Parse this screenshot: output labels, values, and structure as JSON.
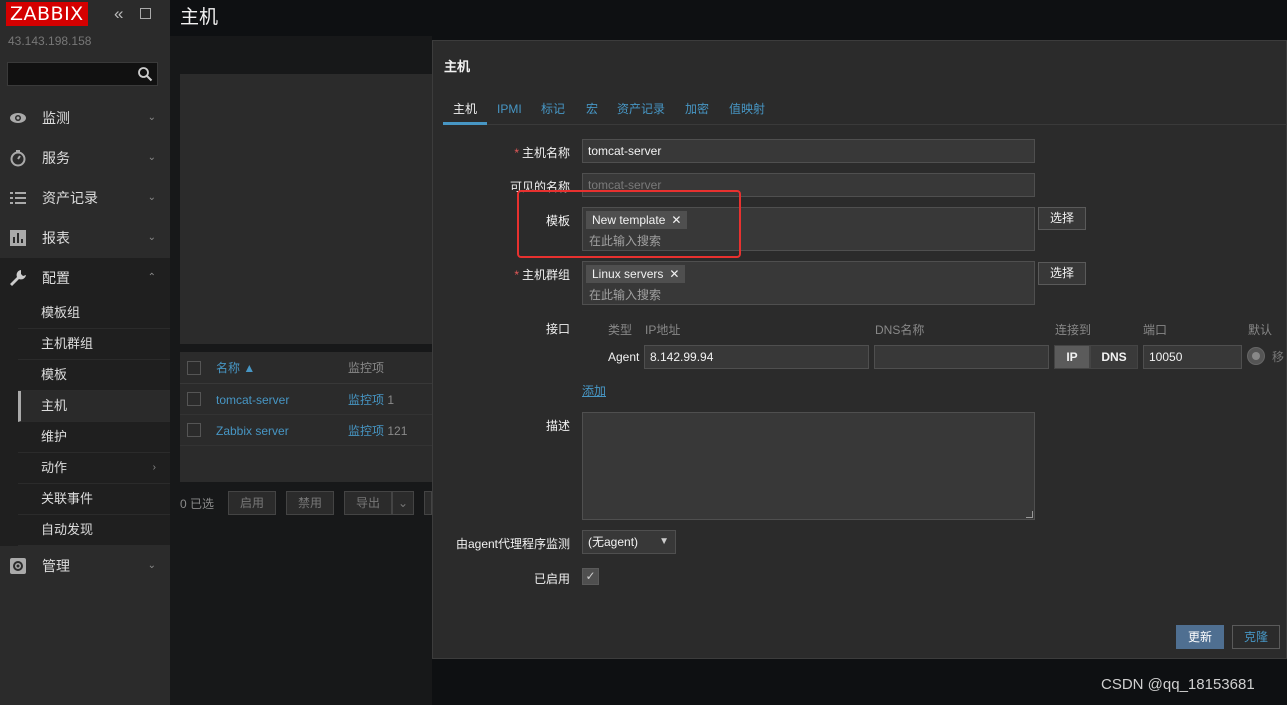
{
  "sidebar": {
    "logo": "ZABBIX",
    "server_ip": "43.143.198.158",
    "menu": [
      {
        "label": "监测",
        "icon": "eye-icon"
      },
      {
        "label": "服务",
        "icon": "stopwatch-icon"
      },
      {
        "label": "资产记录",
        "icon": "list-icon"
      },
      {
        "label": "报表",
        "icon": "bar-chart-icon"
      },
      {
        "label": "配置",
        "icon": "wrench-icon"
      },
      {
        "label": "管理",
        "icon": "gear-icon"
      }
    ],
    "submenu": [
      {
        "label": "模板组"
      },
      {
        "label": "主机群组"
      },
      {
        "label": "模板"
      },
      {
        "label": "主机"
      },
      {
        "label": "维护"
      },
      {
        "label": "动作"
      },
      {
        "label": "关联事件"
      },
      {
        "label": "自动发现"
      }
    ]
  },
  "page": {
    "title": "主机"
  },
  "host_table": {
    "columns": {
      "name": "名称 ▲",
      "items": "监控项"
    },
    "rows": [
      {
        "name": "tomcat-server",
        "items_link": "监控项",
        "items_count": "1"
      },
      {
        "name": "Zabbix server",
        "items_link": "监控项",
        "items_count": "121"
      }
    ],
    "selected": "0 已选",
    "buttons": {
      "enable": "启用",
      "disable": "禁用",
      "export": "导出"
    }
  },
  "modal": {
    "title": "主机",
    "tabs": [
      "主机",
      "IPMI",
      "标记",
      "宏",
      "资产记录",
      "加密",
      "值映射"
    ],
    "labels": {
      "host_name": "主机名称",
      "visible_name": "可见的名称",
      "templates": "模板",
      "host_groups": "主机群组",
      "interfaces": "接口",
      "description": "描述",
      "proxy": "由agent代理程序监测",
      "enabled": "已启用"
    },
    "host_name": "tomcat-server",
    "visible_name_placeholder": "tomcat-server",
    "template_chip": "New template",
    "group_chip": "Linux servers",
    "search_placeholder": "在此输入搜索",
    "select_button": "选择",
    "interface_headers": {
      "type": "类型",
      "ip": "IP地址",
      "dns": "DNS名称",
      "connect": "连接到",
      "port": "端口",
      "default": "默认"
    },
    "interface": {
      "type": "Agent",
      "ip": "8.142.99.94",
      "dns": "",
      "conn_ip": "IP",
      "conn_dns": "DNS",
      "port": "10050",
      "remove": "移"
    },
    "add_link": "添加",
    "proxy_value": "(无agent)",
    "enabled_checked": true,
    "buttons": {
      "update": "更新",
      "clone": "克隆"
    }
  },
  "watermark": "CSDN @qq_18153681"
}
